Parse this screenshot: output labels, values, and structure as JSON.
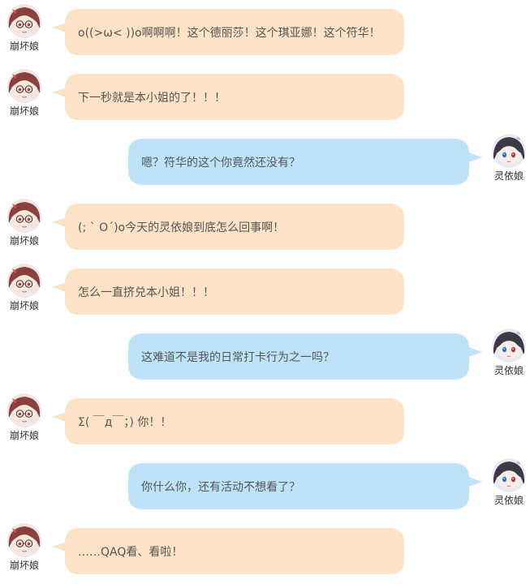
{
  "messages": [
    {
      "side": "left",
      "character": "honkai-girl",
      "name": "崩坏娘",
      "text": "o((>ω< ))o啊啊啊！这个德丽莎！这个琪亚娜！这个符华！"
    },
    {
      "side": "left",
      "character": "honkai-girl",
      "name": "崩坏娘",
      "text": "下一秒就是本小姐的了！！！"
    },
    {
      "side": "right",
      "character": "lingyi-girl",
      "name": "灵依娘",
      "text": "嗯？符华的这个你竟然还没有？"
    },
    {
      "side": "left",
      "character": "honkai-girl",
      "name": "崩坏娘",
      "text": "(; ` O´)o今天的灵依娘到底怎么回事啊！"
    },
    {
      "side": "left",
      "character": "honkai-girl",
      "name": "崩坏娘",
      "text": "怎么一直挤兑本小姐！！！"
    },
    {
      "side": "right",
      "character": "lingyi-girl",
      "name": "灵依娘",
      "text": "这难道不是我的日常打卡行为之一吗？"
    },
    {
      "side": "left",
      "character": "honkai-girl",
      "name": "崩坏娘",
      "text": "Σ( ￣д￣；) 你！！"
    },
    {
      "side": "right",
      "character": "lingyi-girl",
      "name": "灵依娘",
      "text": "你什么你，还有活动不想看了？"
    },
    {
      "side": "left",
      "character": "honkai-girl",
      "name": "崩坏娘",
      "text": "……QAQ看、看啦！"
    }
  ],
  "colors": {
    "left_bubble": "#fde3c6",
    "right_bubble": "#bde3f8",
    "text": "#555555"
  },
  "icons": {
    "honkai-girl": "avatar-honkai-girl-icon",
    "lingyi-girl": "avatar-lingyi-girl-icon"
  }
}
